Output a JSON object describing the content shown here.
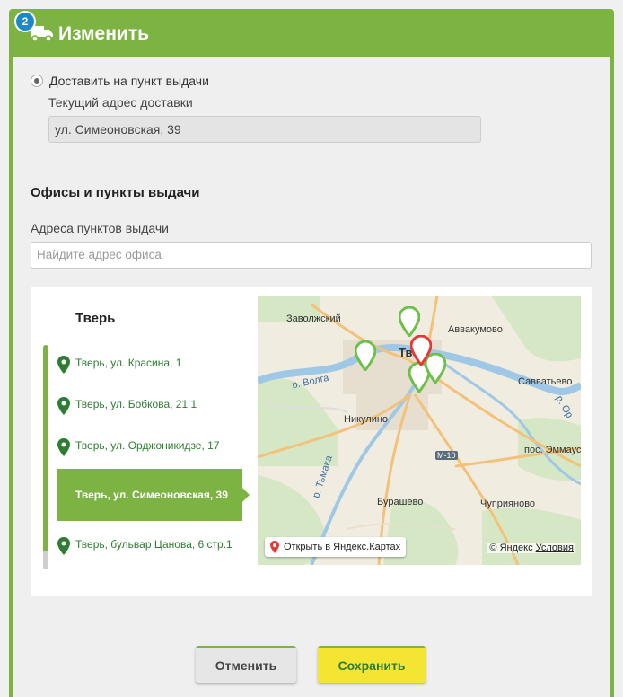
{
  "header": {
    "step": "2",
    "title": "Изменить",
    "truck_icon": "truck-icon"
  },
  "delivery": {
    "radio_label": "Доставить на пункт выдачи",
    "current_address_label": "Текущий адрес доставки",
    "current_address_value": "ул. Симеоновская, 39"
  },
  "offices": {
    "section_title": "Офисы и пункты выдачи",
    "points_label": "Адреса пунктов выдачи",
    "search_placeholder": "Найдите адрес офиса",
    "city": "Тверь",
    "items": [
      {
        "label": "Тверь, ул. Красина, 1"
      },
      {
        "label": "Тверь, ул. Бобкова, 21 1"
      },
      {
        "label": "Тверь, ул. Орджоникидзе, 17"
      },
      {
        "label": "Тверь, ул. Симеоновская, 39"
      },
      {
        "label": "Тверь, бульвар Цанова, 6 стр.1"
      }
    ],
    "selected_index": 3
  },
  "map": {
    "labels": {
      "zavolzhsky": "Заволжский",
      "avvakumovo": "Аввакумово",
      "tver": "Тве",
      "volga": "р. Волга",
      "savvatevo": "Савватьево",
      "nikulino": "Никулино",
      "orsha": "р. Ор",
      "emmaus": "пос. Эммаус",
      "m10": "М-10",
      "tmaka": "р. Тьмака",
      "burashevo": "Бурашево",
      "chupriyanovo": "Чуприяново"
    },
    "open_button": "Открыть в Яндекс.Картах",
    "copyright": "© Яндекс",
    "terms": "Условия"
  },
  "buttons": {
    "cancel": "Отменить",
    "save": "Сохранить"
  },
  "colors": {
    "accent": "#7cb342",
    "badge": "#1e88c8",
    "save_bg": "#f5e533",
    "pin_green": "#6cc04a",
    "pin_red": "#e53935"
  }
}
